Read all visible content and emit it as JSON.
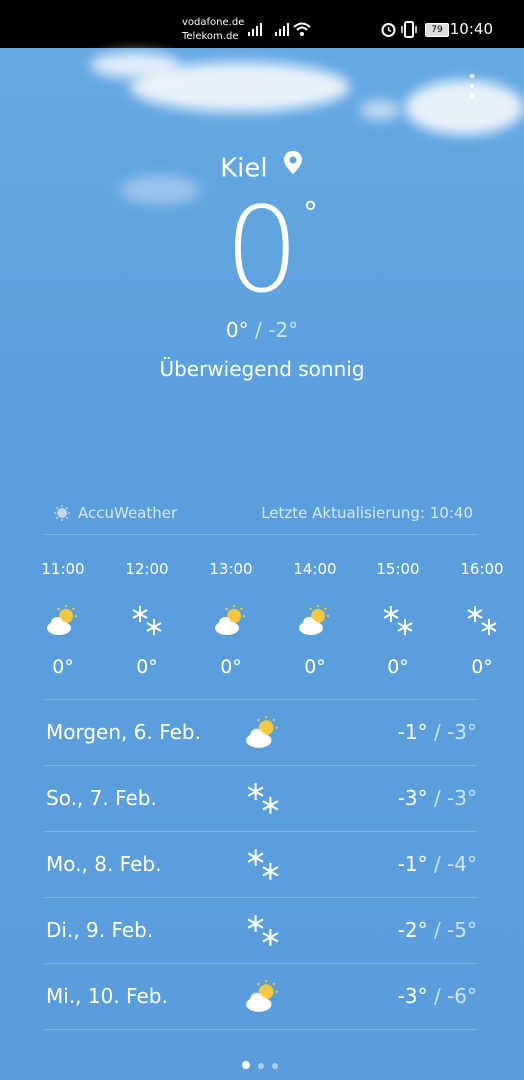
{
  "status_bar": {
    "carrier1": "vodafone.de",
    "carrier2": "Telekom.de",
    "battery": "79",
    "time": "10:40"
  },
  "city": "Kiel",
  "current": {
    "temp": "0",
    "degree_symbol": "°",
    "high": "0°",
    "separator": "/",
    "low": "-2°",
    "condition": "Überwiegend sonnig"
  },
  "source": "AccuWeather",
  "last_update": "Letzte Aktualisierung: 10:40",
  "hourly": [
    {
      "time": "11:00",
      "icon": "partly-sunny-icon",
      "temp": "0°"
    },
    {
      "time": "12:00",
      "icon": "snow-icon",
      "temp": "0°"
    },
    {
      "time": "13:00",
      "icon": "partly-sunny-icon",
      "temp": "0°"
    },
    {
      "time": "14:00",
      "icon": "partly-sunny-icon",
      "temp": "0°"
    },
    {
      "time": "15:00",
      "icon": "snow-icon",
      "temp": "0°"
    },
    {
      "time": "16:00",
      "icon": "snow-icon",
      "temp": "0°"
    }
  ],
  "daily": [
    {
      "day": "Morgen, 6. Feb.",
      "icon": "partly-sunny-icon",
      "high": "-1°",
      "sep": "/",
      "low": "-3°"
    },
    {
      "day": "So., 7. Feb.",
      "icon": "snow-icon",
      "high": "-3°",
      "sep": "/",
      "low": "-3°"
    },
    {
      "day": "Mo., 8. Feb.",
      "icon": "snow-icon",
      "high": "-1°",
      "sep": "/",
      "low": "-4°"
    },
    {
      "day": "Di., 9. Feb.",
      "icon": "snow-icon",
      "high": "-2°",
      "sep": "/",
      "low": "-5°"
    },
    {
      "day": "Mi., 10. Feb.",
      "icon": "partly-sunny-icon",
      "high": "-3°",
      "sep": "/",
      "low": "-6°"
    }
  ],
  "pager": {
    "pages": 3,
    "active": 1
  },
  "colors": {
    "sky": "#5b9ddb",
    "sun": "#f5c842",
    "cloud": "#ffffff"
  }
}
